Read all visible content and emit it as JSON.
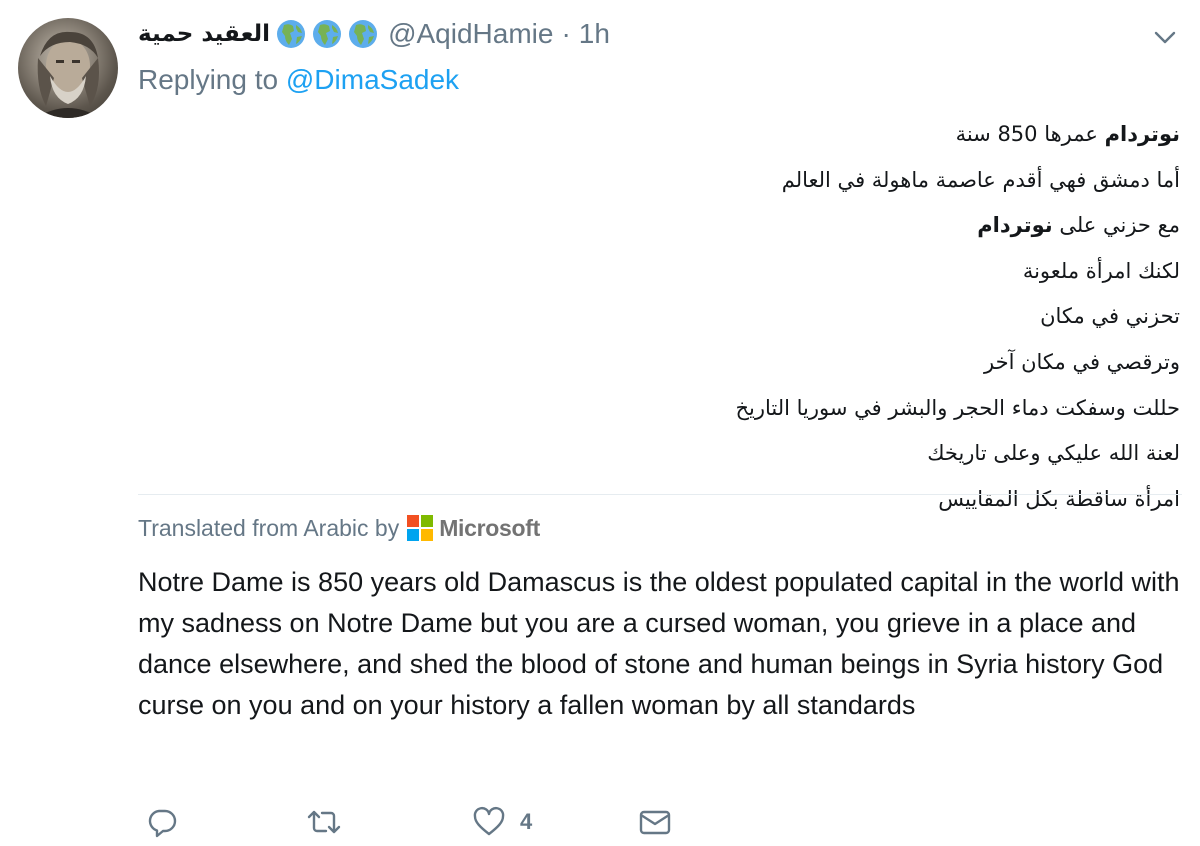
{
  "tweet": {
    "display_name": "العقيد حمية",
    "flag_icons": [
      "earth-africa-icon",
      "earth-africa-icon",
      "earth-africa-icon"
    ],
    "handle": "@AqidHamie",
    "separator": "·",
    "time": "1h",
    "menu_icon": "chevron-down-icon",
    "replying_prefix": "Replying to",
    "replying_to": "@DimaSadek",
    "arabic_lines": [
      {
        "bold": "نوتردام",
        "rest": " عمرها 850 سنة"
      },
      {
        "bold": "",
        "rest": "أما دمشق فهي أقدم عاصمة ماهولة في العالم"
      },
      {
        "bold": "",
        "rest": "مع حزني على ",
        "bold_end": "نوتردام"
      },
      {
        "bold": "",
        "rest": "لكنك امرأة ملعونة"
      },
      {
        "bold": "",
        "rest": "تحزني في مكان"
      },
      {
        "bold": "",
        "rest": "وترقصي في مكان آخر"
      },
      {
        "bold": "",
        "rest": "حللت وسفكت دماء الحجر والبشر في سوريا التاريخ"
      },
      {
        "bold": "",
        "rest": "لعنة الله عليكي وعلى تاريخك"
      },
      {
        "bold": "",
        "rest": "امرأة ساقطة بكل المقاييس"
      }
    ],
    "translation_label": "Translated from Arabic by",
    "translation_provider": "Microsoft",
    "translated_text": "Notre Dame is 850 years old Damascus is the oldest populated capital in the world with my sadness on Notre Dame but you are a cursed woman, you grieve in a place and dance elsewhere, and shed the blood of stone and human beings in Syria history God curse on you and on your history a fallen woman by all standards",
    "actions": {
      "reply_icon": "reply-icon",
      "retweet_icon": "retweet-icon",
      "like_icon": "heart-icon",
      "like_count": "4",
      "dm_icon": "envelope-icon"
    }
  },
  "colors": {
    "text": "#14171a",
    "secondary": "#657786",
    "link": "#1da1f2",
    "divider": "#e6ecf0"
  }
}
